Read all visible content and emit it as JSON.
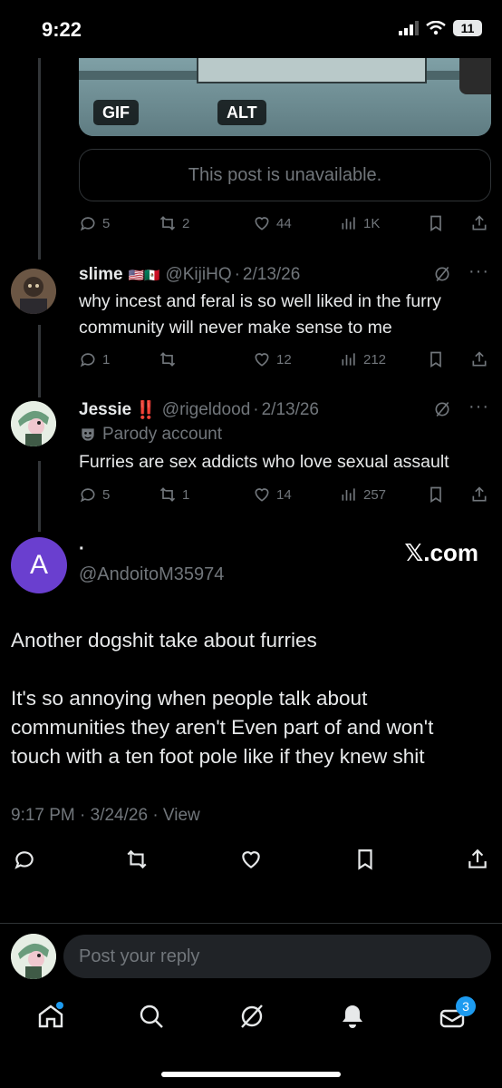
{
  "status_bar": {
    "time": "9:22",
    "battery": "11"
  },
  "media": {
    "badge_gif": "GIF",
    "badge_alt": "ALT"
  },
  "quoted": {
    "unavailable": "This post is unavailable."
  },
  "top_actions": {
    "replies": "5",
    "reposts": "2",
    "likes": "44",
    "views": "1K"
  },
  "replies": [
    {
      "name": "slime",
      "flags": "🇺🇸🇲🇽",
      "handle": "@KijiHQ",
      "date": "2/13/26",
      "text_line1": "why incest and feral is so well liked in the furry",
      "text_line2": "community will never make sense to me",
      "replies": "1",
      "reposts": "",
      "likes": "12",
      "views": "212"
    },
    {
      "name": "Jessie",
      "emoji": "‼️",
      "handle": "@rigeldood",
      "date": "2/13/26",
      "parody": "Parody account",
      "text_line1": "Furries are sex addicts who love sexual assault",
      "replies": "5",
      "reposts": "1",
      "likes": "14",
      "views": "257"
    }
  ],
  "main_post": {
    "avatar_letter": "A",
    "name": "·",
    "handle": "@AndoitoM35974",
    "watermark": "𝕏.com",
    "paragraph1": "Another dogshit take about furries",
    "line2": "It's so annoying when people talk about",
    "line3": "communities they aren't Even part of and won't",
    "line4": "touch with a ten foot pole like if they knew shit",
    "timestamp": "9:17 PM · 3/24/26 · View"
  },
  "reply_bar": {
    "placeholder": "Post your reply"
  },
  "tab_bar": {
    "messages_badge": "3"
  },
  "colors": {
    "background": "#000000",
    "text": "#e7e9ea",
    "muted": "#71767b",
    "accent": "#1d9bf0",
    "avatar_purple": "#6a3fcf"
  }
}
